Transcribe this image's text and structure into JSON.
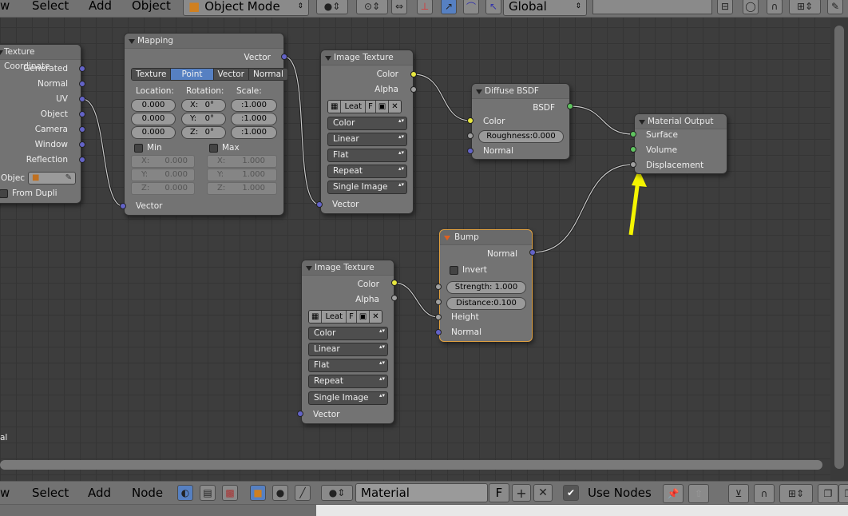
{
  "header": {
    "menus": [
      "w",
      "Select",
      "Add",
      "Object"
    ],
    "mode": "Object Mode",
    "orientation": "Global"
  },
  "nodes": {
    "texcoord": {
      "title": "Texture Coordinate",
      "outputs": [
        "Generated",
        "Normal",
        "UV",
        "Object",
        "Camera",
        "Window",
        "Reflection"
      ],
      "object_label": "Objec",
      "from_dupli": "From Dupli"
    },
    "mapping": {
      "title": "Mapping",
      "output": "Vector",
      "modes": [
        "Texture",
        "Point",
        "Vector",
        "Normal"
      ],
      "active_mode": "Point",
      "location_label": "Location:",
      "rotation_label": "Rotation:",
      "scale_label": "Scale:",
      "location": [
        "0.000",
        "0.000",
        "0.000"
      ],
      "rotation": [
        "X:",
        "Y:",
        "Z:"
      ],
      "rotation_values": [
        "0°",
        "0°",
        "0°"
      ],
      "scale": [
        ":1.000",
        ":1.000",
        ":1.000"
      ],
      "min_label": "Min",
      "max_label": "Max",
      "min": [
        "X:",
        "Y:",
        "Z:"
      ],
      "min_values": [
        "0.000",
        "0.000",
        "0.000"
      ],
      "max": [
        "X:",
        "Y:",
        "Z:"
      ],
      "max_values": [
        "1.000",
        "1.000",
        "1.000"
      ],
      "input": "Vector"
    },
    "imgtex1": {
      "title": "Image Texture",
      "outputs": [
        "Color",
        "Alpha"
      ],
      "image_name": "Leat",
      "image_flag": "F",
      "dropdowns": [
        "Color",
        "Linear",
        "Flat",
        "Repeat",
        "Single Image"
      ],
      "input": "Vector"
    },
    "diffuse": {
      "title": "Diffuse BSDF",
      "output": "BSDF",
      "inputs": [
        "Color",
        "Normal"
      ],
      "roughness": "Roughness:0.000"
    },
    "output": {
      "title": "Material Output",
      "inputs": [
        "Surface",
        "Volume",
        "Displacement"
      ]
    },
    "bump": {
      "title": "Bump",
      "output": "Normal",
      "invert": "Invert",
      "strength": "Strength: 1.000",
      "distance": "Distance:0.100",
      "inputs": [
        "Height",
        "Normal"
      ]
    },
    "imgtex2": {
      "title": "Image Texture",
      "outputs": [
        "Color",
        "Alpha"
      ],
      "image_name": "Leat",
      "image_flag": "F",
      "dropdowns": [
        "Color",
        "Linear",
        "Flat",
        "Repeat",
        "Single Image"
      ],
      "input": "Vector"
    }
  },
  "stray_label": "al",
  "footer": {
    "menus": [
      "w",
      "Select",
      "Add",
      "Node"
    ],
    "material": "Material",
    "material_flag": "F",
    "use_nodes": "Use Nodes"
  },
  "colors": {
    "arrow": "#f4f400",
    "selected_outline": "#e0a040",
    "color_socket": "#e8e840",
    "shader_socket": "#5fc45f",
    "vector_socket": "#6363c7",
    "float_socket": "#a0a0a0"
  }
}
